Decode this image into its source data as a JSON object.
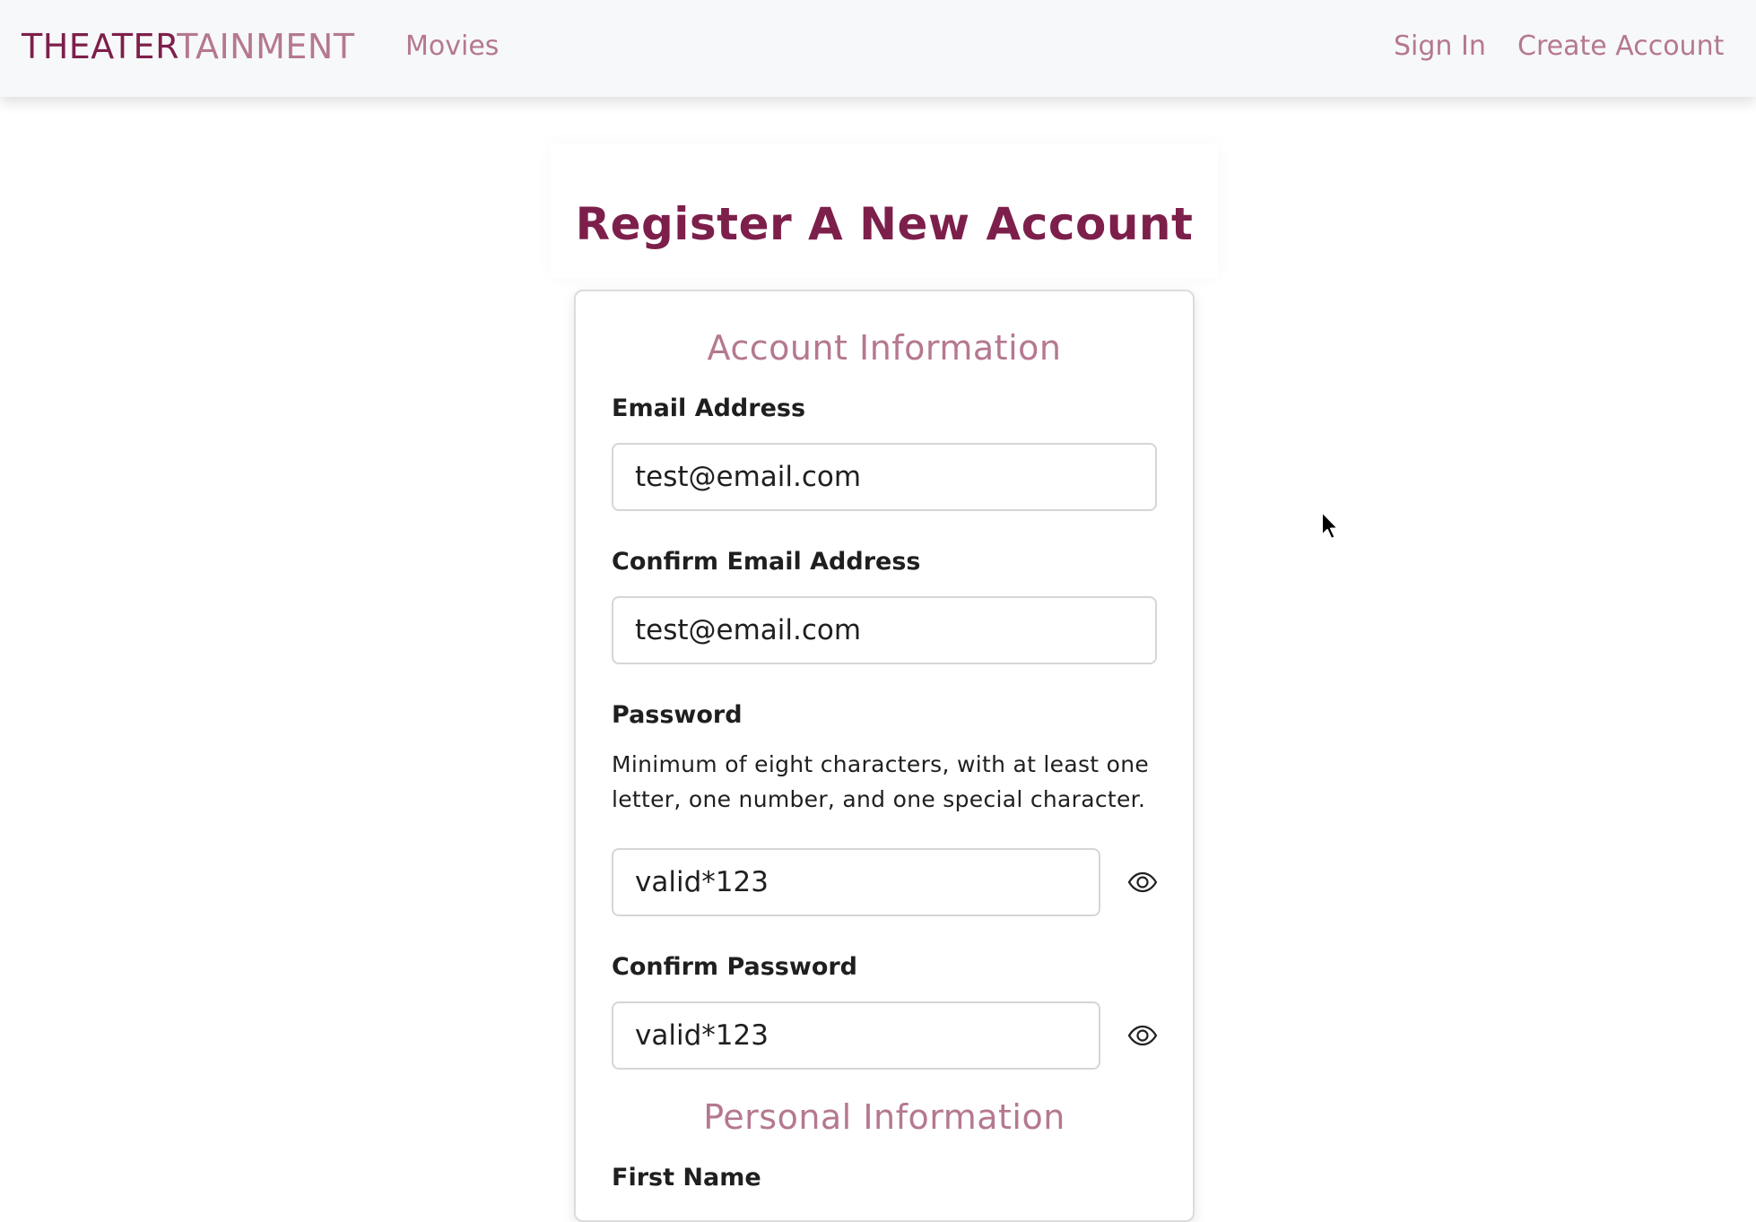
{
  "nav": {
    "brand_primary": "THEATER",
    "brand_secondary": "TAINMENT",
    "movies": "Movies",
    "sign_in": "Sign In",
    "create_account": "Create Account"
  },
  "page": {
    "title": "Register A New Account"
  },
  "account_section": {
    "title": "Account Information",
    "email_label": "Email Address",
    "email_value": "test@email.com",
    "confirm_email_label": "Confirm Email Address",
    "confirm_email_value": "test@email.com",
    "password_label": "Password",
    "password_help": "Minimum of eight characters, with at least one letter, one number, and one special character.",
    "password_value": "valid*123",
    "confirm_password_label": "Confirm Password",
    "confirm_password_value": "valid*123"
  },
  "personal_section": {
    "title": "Personal Information",
    "first_name_label": "First Name"
  },
  "icons": {
    "show_password": "eye-icon",
    "cursor": "mouse-pointer-icon"
  },
  "colors": {
    "brand_dark": "#7d1f4b",
    "brand_light": "#b57890",
    "navbar_bg": "#f7f8fa",
    "text": "#1f1f1f"
  }
}
